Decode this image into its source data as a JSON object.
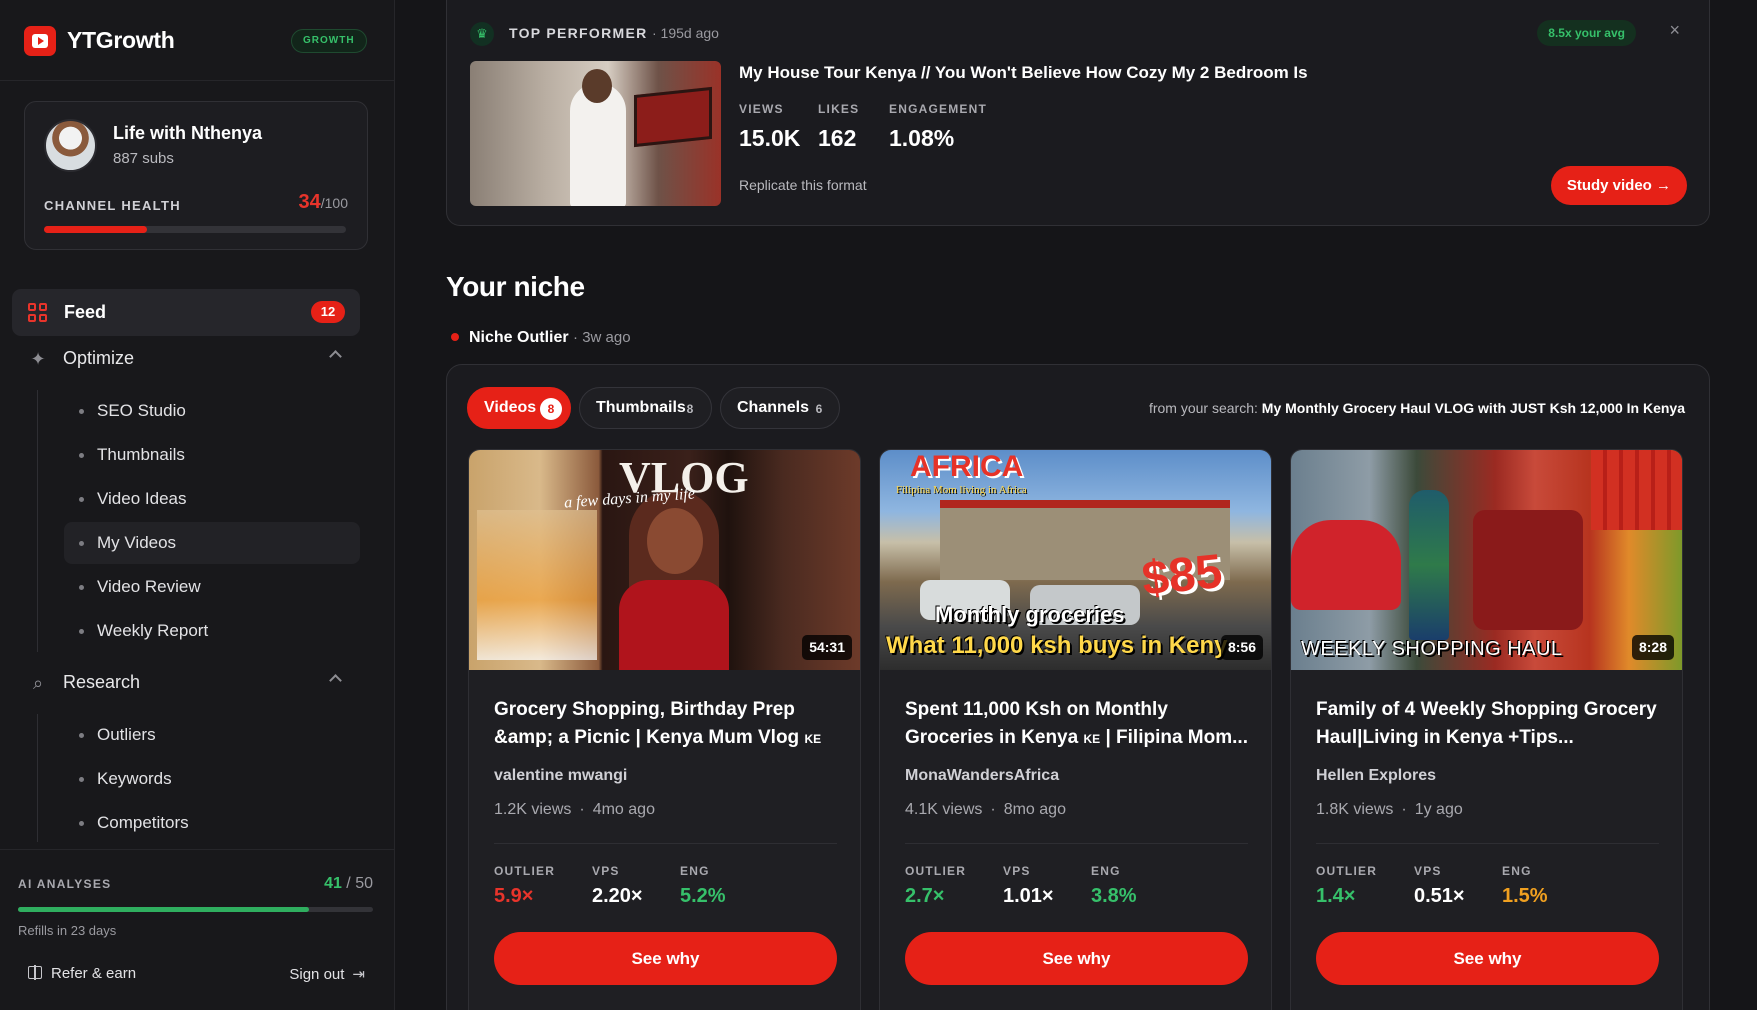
{
  "brand": {
    "name": "YTGrowth",
    "plan": "GROWTH"
  },
  "channel": {
    "name": "Life with Nthenya",
    "subs": "887 subs",
    "health_label": "CHANNEL HEALTH",
    "health_score": "34",
    "health_max": "/100",
    "health_fraction": 0.34
  },
  "nav": {
    "feed_label": "Feed",
    "feed_count": "12",
    "optimize": {
      "label": "Optimize",
      "items": [
        "SEO Studio",
        "Thumbnails",
        "Video Ideas",
        "My Videos",
        "Video Review",
        "Weekly Report"
      ],
      "active": "My Videos"
    },
    "research": {
      "label": "Research",
      "items": [
        "Outliers",
        "Keywords",
        "Competitors"
      ]
    }
  },
  "ai": {
    "label": "AI ANALYSES",
    "used": "41",
    "sep": " / ",
    "total": "50",
    "refill": "Refills in 23 days",
    "fraction": 0.82
  },
  "footer": {
    "refer": "Refer & earn",
    "signout": "Sign out"
  },
  "top_performer": {
    "label": "TOP PERFORMER",
    "age": "· 195d ago",
    "badge": "8.5x your avg",
    "close": "×",
    "title": "My House Tour Kenya // You Won't Believe How Cozy My 2 Bedroom Is",
    "stats": [
      {
        "label": "VIEWS",
        "value": "15.0K"
      },
      {
        "label": "LIKES",
        "value": "162"
      },
      {
        "label": "ENGAGEMENT",
        "value": "1.08%"
      }
    ],
    "replicate": "Replicate this format",
    "cta": "Study video →"
  },
  "niche": {
    "title": "Your niche",
    "tag_name": "Niche Outlier",
    "tag_age": "· 3w ago",
    "tabs": [
      {
        "label": "Videos",
        "count": "8"
      },
      {
        "label": "Thumbnails",
        "count": "8"
      },
      {
        "label": "Channels",
        "count": "6"
      }
    ],
    "search_prefix": "from your search: ",
    "search_query": "My Monthly Grocery Haul VLOG with JUST Ksh 12,000 In Kenya"
  },
  "videos": [
    {
      "title": "Grocery Shopping, Birthday Prep &amp; a Picnic | Kenya Mum Vlog",
      "flag": "KE",
      "channel": "valentine mwangi",
      "views": "1.2K views",
      "age": "4mo ago",
      "duration": "54:31",
      "thumb_text": [
        "VLOG",
        "a few days in my life"
      ],
      "metrics": [
        {
          "label": "OUTLIER",
          "value": "5.9×",
          "color": "#e8342b"
        },
        {
          "label": "VPS",
          "value": "2.20×",
          "color": "#ffffff"
        },
        {
          "label": "ENG",
          "value": "5.2%",
          "color": "#36c06a"
        }
      ],
      "cta": "See why"
    },
    {
      "title": "Spent 11,000 Ksh on Monthly Groceries in Kenya",
      "flag": "KE",
      "title_tail": "| Filipina Mom...",
      "channel": "MonaWandersAfrica",
      "views": "4.1K views",
      "age": "8mo ago",
      "duration": "8:56",
      "thumb_text": [
        "AFRICA",
        "Filipina Mom living in Africa",
        "Monthly groceries",
        "What 11,000 ksh buys in Keny",
        "$85"
      ],
      "metrics": [
        {
          "label": "OUTLIER",
          "value": "2.7×",
          "color": "#36c06a"
        },
        {
          "label": "VPS",
          "value": "1.01×",
          "color": "#ffffff"
        },
        {
          "label": "ENG",
          "value": "3.8%",
          "color": "#36c06a"
        }
      ],
      "cta": "See why"
    },
    {
      "title": "Family of 4 Weekly Shopping Grocery Haul|Living in Kenya +Tips...",
      "channel": "Hellen Explores",
      "views": "1.8K views",
      "age": "1y ago",
      "duration": "8:28",
      "thumb_text": [
        "WEEKLY SHOPPING HAUL"
      ],
      "metrics": [
        {
          "label": "OUTLIER",
          "value": "1.4×",
          "color": "#36c06a"
        },
        {
          "label": "VPS",
          "value": "0.51×",
          "color": "#ffffff"
        },
        {
          "label": "ENG",
          "value": "1.5%",
          "color": "#f0a020"
        }
      ],
      "cta": "See why"
    }
  ],
  "colors": {
    "accent": "#e62117",
    "good": "#36c06a",
    "warn": "#f0a020",
    "bad": "#e8342b"
  }
}
